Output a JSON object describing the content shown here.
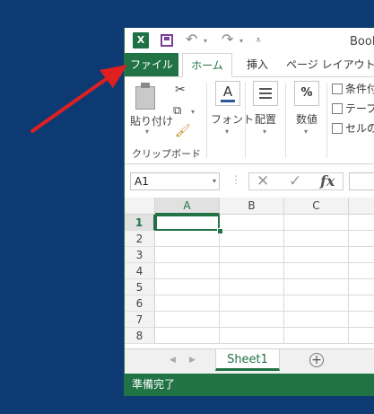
{
  "window": {
    "title": "Book",
    "app_icon": "X"
  },
  "quick_access": {
    "icons": [
      "excel-logo",
      "save-icon",
      "undo-icon",
      "redo-icon",
      "customize-icon"
    ]
  },
  "ribbon_tabs": {
    "file": "ファイル",
    "home": "ホーム",
    "insert": "挿入",
    "page_layout": "ページ レイアウト"
  },
  "clipboard_group": {
    "paste_label": "貼り付け",
    "group_label": "クリップボード"
  },
  "font_group": {
    "label": "フォント"
  },
  "alignment_group": {
    "label": "配置"
  },
  "number_group": {
    "label": "数値",
    "icon_text": "%"
  },
  "styles_group": {
    "items": [
      "条件付",
      "テーブ",
      "セルの"
    ]
  },
  "formula_bar": {
    "name_box": "A1",
    "fx": "fx",
    "dots": "⋮"
  },
  "grid": {
    "columns": [
      "A",
      "B",
      "C"
    ],
    "rows": [
      "1",
      "2",
      "3",
      "4",
      "5",
      "6",
      "7",
      "8"
    ],
    "active_cell": "A1"
  },
  "sheets": {
    "tabs": [
      "Sheet1"
    ],
    "add_symbol": "+"
  },
  "status_bar": {
    "text": "準備完了"
  },
  "colors": {
    "desktop": "#0d3a73",
    "excel_green": "#217346",
    "arrow_red": "#e02020"
  }
}
